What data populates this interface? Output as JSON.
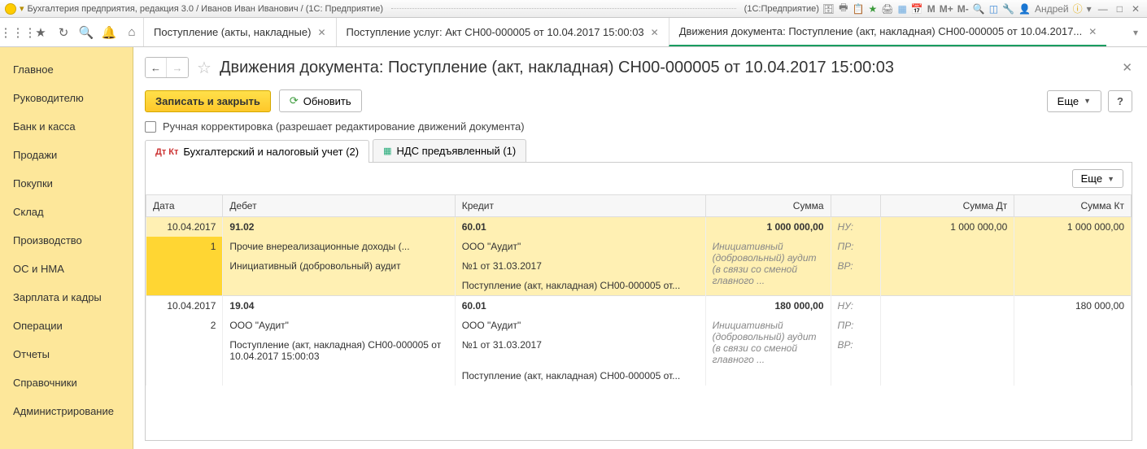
{
  "titlebar": {
    "text_left": "Бухгалтерия предприятия, редакция 3.0 / Иванов Иван Иванович / (1С: Предприятие)",
    "text_right": "(1С:Предприятие)",
    "user": "Андрей",
    "m": "M",
    "mplus": "M+",
    "mminus": "M-"
  },
  "tabs": [
    {
      "label": "Поступление (акты, накладные)",
      "closable": true,
      "active": false
    },
    {
      "label": "Поступление услуг: Акт CH00-000005 от 10.04.2017 15:00:03",
      "closable": true,
      "active": false
    },
    {
      "label": "Движения документа: Поступление (акт, накладная) CH00-000005 от 10.04.2017...",
      "closable": true,
      "active": true
    }
  ],
  "sidebar": [
    "Главное",
    "Руководителю",
    "Банк и касса",
    "Продажи",
    "Покупки",
    "Склад",
    "Производство",
    "ОС и НМА",
    "Зарплата и кадры",
    "Операции",
    "Отчеты",
    "Справочники",
    "Администрирование"
  ],
  "page": {
    "title": "Движения документа: Поступление (акт, накладная) CH00-000005 от 10.04.2017 15:00:03",
    "save_close": "Записать и закрыть",
    "refresh": "Обновить",
    "more": "Еще",
    "help": "?",
    "checkbox_label": "Ручная корректировка (разрешает редактирование движений документа)"
  },
  "subtabs": [
    {
      "label": "Бухгалтерский и налоговый учет (2)",
      "active": true
    },
    {
      "label": "НДС предъявленный (1)",
      "active": false
    }
  ],
  "grid": {
    "more": "Еще",
    "headers": {
      "date": "Дата",
      "debit": "Дебет",
      "credit": "Кредит",
      "sum": "Сумма",
      "sum_dt": "Сумма Дт",
      "sum_kt": "Сумма Кт"
    },
    "labels": {
      "nu": "НУ:",
      "pr": "ПР:",
      "vr": "ВР:"
    },
    "rows": [
      {
        "selected": true,
        "date": "10.04.2017",
        "idx": "1",
        "debit_acc": "91.02",
        "credit_acc": "60.01",
        "sum": "1 000 000,00",
        "sum_dt": "1 000 000,00",
        "sum_kt": "1 000 000,00",
        "debit_l1": "Прочие внереализационные доходы (...",
        "debit_l2": "Инициативный (добровольный) аудит",
        "credit_l1": "ООО \"Аудит\"",
        "credit_l2": "№1 от 31.03.2017",
        "credit_l3": "Поступление (акт, накладная) CH00-000005 от...",
        "sum_note": "Инициативный (добровольный) аудит (в связи со сменой главного ..."
      },
      {
        "selected": false,
        "date": "10.04.2017",
        "idx": "2",
        "debit_acc": "19.04",
        "credit_acc": "60.01",
        "sum": "180 000,00",
        "sum_dt": "",
        "sum_kt": "180 000,00",
        "debit_l1": "ООО \"Аудит\"",
        "debit_l2": "Поступление (акт, накладная) CH00-000005 от 10.04.2017 15:00:03",
        "credit_l1": "ООО \"Аудит\"",
        "credit_l2": "№1 от 31.03.2017",
        "credit_l3": "Поступление (акт, накладная) CH00-000005 от...",
        "sum_note": "Инициативный (добровольный) аудит (в связи со сменой главного ..."
      }
    ]
  }
}
